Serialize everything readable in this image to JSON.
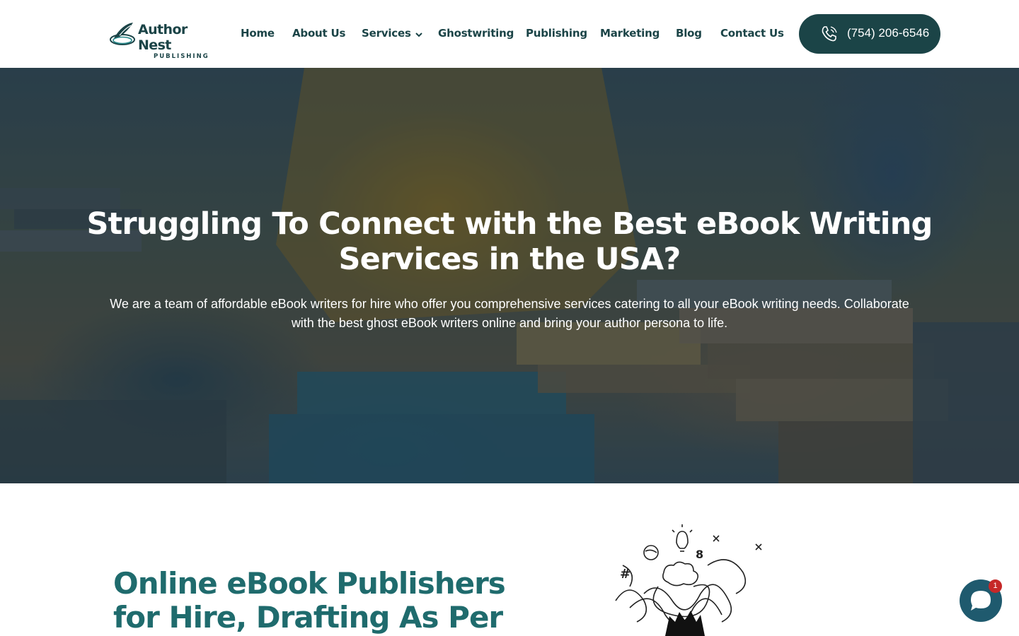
{
  "brand": {
    "name": "Author Nest",
    "tagline": "PUBLISHING"
  },
  "nav": {
    "items": [
      {
        "label": "Home"
      },
      {
        "label": "About Us"
      },
      {
        "label": "Services",
        "has_dropdown": true
      },
      {
        "label": "Ghostwriting"
      },
      {
        "label": "Publishing"
      },
      {
        "label": "Marketing"
      },
      {
        "label": "Blog"
      },
      {
        "label": "Contact Us"
      }
    ],
    "phone": "(754) 206-6546"
  },
  "hero": {
    "title": "Struggling To Connect with the Best eBook Writing Services in the USA?",
    "subtitle": "We are a team of affordable eBook writers for hire who offer you comprehensive services catering to all your eBook writing needs. Collaborate with the best ghost eBook writers online and bring your author persona to life."
  },
  "section": {
    "title": "Online eBook Publishers for Hire, Drafting As Per"
  },
  "chat": {
    "badge_count": "1"
  },
  "colors": {
    "brand_dark": "#1b4447",
    "heading_teal": "#1f6b6d",
    "chat_bubble": "#1f5a6e",
    "badge_red": "#c62828"
  }
}
